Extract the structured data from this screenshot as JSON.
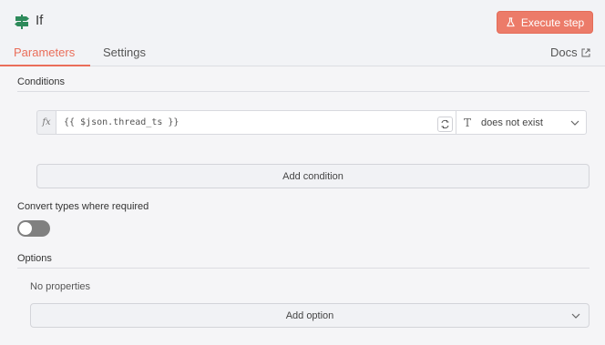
{
  "node": {
    "title": "If",
    "icon": "signpost-icon",
    "execute_label": "Execute step"
  },
  "tabs": [
    {
      "label": "Parameters",
      "active": true
    },
    {
      "label": "Settings",
      "active": false
    }
  ],
  "docs_label": "Docs",
  "conditions": {
    "heading": "Conditions",
    "rows": [
      {
        "expression": "{{ $json.thread_ts }}",
        "operator_type_icon": "T",
        "operator": "does not exist"
      }
    ],
    "add_label": "Add condition"
  },
  "convert_types": {
    "label": "Convert types where required",
    "enabled": false
  },
  "options": {
    "heading": "Options",
    "empty_text": "No properties",
    "add_label": "Add option"
  },
  "colors": {
    "accent": "#ea6e5a",
    "execute_button": "#ec7b69",
    "node_icon": "#2e8a5b",
    "toggle_off": "#808080"
  }
}
